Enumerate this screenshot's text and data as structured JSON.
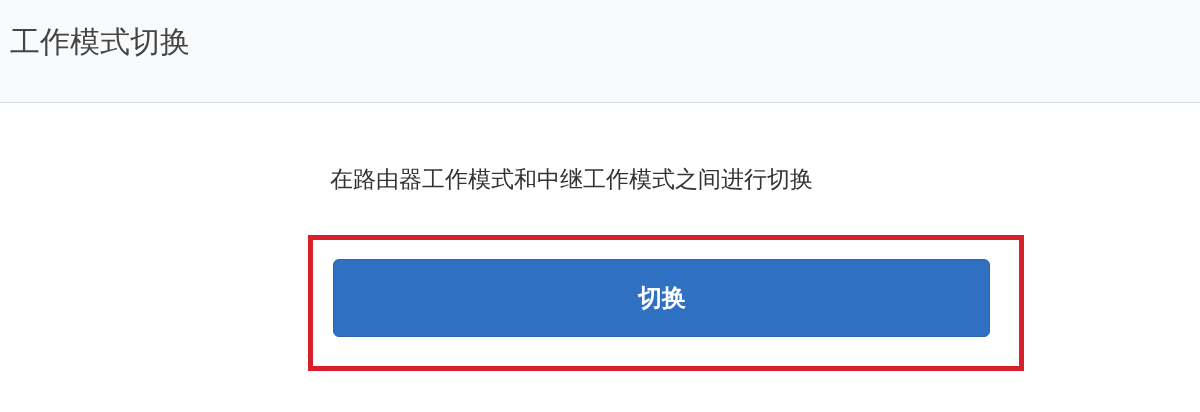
{
  "header": {
    "title": "工作模式切换"
  },
  "description": "在路由器工作模式和中继工作模式之间进行切换",
  "button": {
    "label": "切换",
    "highlighted": true
  }
}
